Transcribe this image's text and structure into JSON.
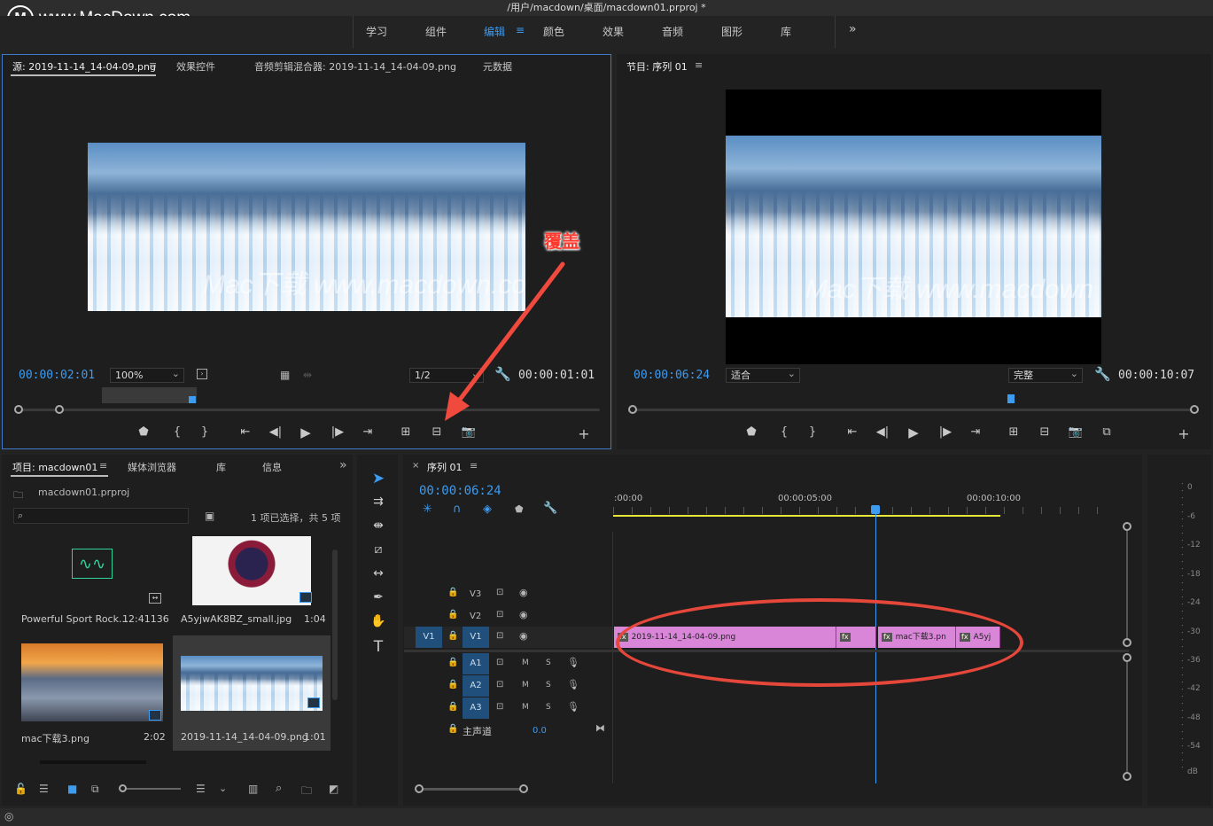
{
  "title": "/用户/macdown/桌面/macdown01.prproj *",
  "watermark_site": "www.MacDown.com",
  "workspaces": [
    "学习",
    "组件",
    "编辑",
    "颜色",
    "效果",
    "音频",
    "图形",
    "库"
  ],
  "active_workspace_index": 2,
  "source_panel": {
    "tabs": [
      "源: 2019-11-14_14-04-09.png",
      "效果控件",
      "音频剪辑混合器: 2019-11-14_14-04-09.png",
      "元数据"
    ],
    "timecode_current": "00:00:02:01",
    "zoom": "100%",
    "resolution": "1/2",
    "timecode_duration": "00:00:01:01",
    "image_watermark": "Mac下载 www.macdown.com"
  },
  "program_panel": {
    "title": "节目: 序列 01",
    "timecode_current": "00:00:06:24",
    "zoom": "适合",
    "quality": "完整",
    "timecode_duration": "00:00:10:07",
    "image_watermark": "Mac下载 www.macdown"
  },
  "annotation": "覆盖",
  "project_panel": {
    "tabs": [
      "项目: macdown01",
      "媒体浏览器",
      "库",
      "信息"
    ],
    "project_file": "macdown01.prproj",
    "selection_info": "1 项已选择，共 5 项",
    "items": [
      {
        "name": "Powerful Sport Rock...",
        "duration": "12:41136"
      },
      {
        "name": "A5yjwAK8BZ_small.jpg",
        "duration": "1:04"
      },
      {
        "name": "mac下载3.png",
        "duration": "2:02"
      },
      {
        "name": "2019-11-14_14-04-09.png",
        "duration": "1:01"
      }
    ]
  },
  "timeline": {
    "title": "序列 01",
    "timecode": "00:00:06:24",
    "ruler": [
      ":00:00",
      "00:00:05:00",
      "00:00:10:00"
    ],
    "video_tracks": [
      "V3",
      "V2",
      "V1"
    ],
    "source_patch": "V1",
    "audio_tracks": [
      "A1",
      "A2",
      "A3"
    ],
    "mute_label": "M",
    "solo_label": "S",
    "master_label": "主声道",
    "master_value": "0.0",
    "clips": [
      {
        "label": "2019-11-14_14-04-09.png"
      },
      {
        "label": ""
      },
      {
        "label": "mac下载3.pn"
      },
      {
        "label": "A5yj"
      }
    ]
  },
  "meter_ticks": [
    "0",
    "-6",
    "-12",
    "-18",
    "-24",
    "-30",
    "-36",
    "-42",
    "-48",
    "-54",
    "dB"
  ]
}
